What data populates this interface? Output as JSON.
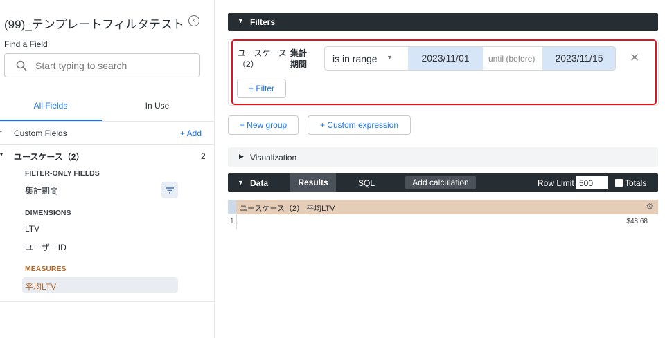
{
  "sidebar": {
    "title": "(99)_テンプレートフィルタテスト",
    "find_label": "Find a Field",
    "search_placeholder": "Start typing to search",
    "tabs": [
      {
        "label": "All Fields"
      },
      {
        "label": "In Use"
      }
    ],
    "custom_fields": "Custom Fields",
    "add_label": "+ Add",
    "view": {
      "name": "ユースケース（2）",
      "count": "2",
      "filter_only_header": "FILTER-ONLY FIELDS",
      "filter_only": [
        "集計期間"
      ],
      "dimensions_header": "DIMENSIONS",
      "dimensions": [
        "LTV",
        "ユーザーID"
      ],
      "measures_header": "MEASURES",
      "measures": [
        "平均LTV"
      ]
    }
  },
  "filters": {
    "header": "Filters",
    "field_view": "ユースケース（2）",
    "field_name": "集計期間",
    "operator": "is in range",
    "from": "2023/11/01",
    "until": "until (before)",
    "to": "2023/11/15",
    "add_filter": "+ Filter",
    "new_group": "+ New group",
    "custom_expression": "+ Custom expression"
  },
  "visualization": {
    "label": "Visualization"
  },
  "data": {
    "label": "Data",
    "tabs": [
      "Results",
      "SQL"
    ],
    "add_calc": "Add calculation",
    "row_limit_label": "Row Limit",
    "row_limit": "500",
    "totals": "Totals",
    "column": "ユースケース（2） 平均LTV",
    "rows": [
      {
        "num": "1",
        "value": "$48.68"
      }
    ]
  },
  "colors": {
    "accent": "#1a73e8",
    "measure": "#b5682a",
    "header_bg": "#e6cdb8",
    "highlight": "#e0141e"
  }
}
